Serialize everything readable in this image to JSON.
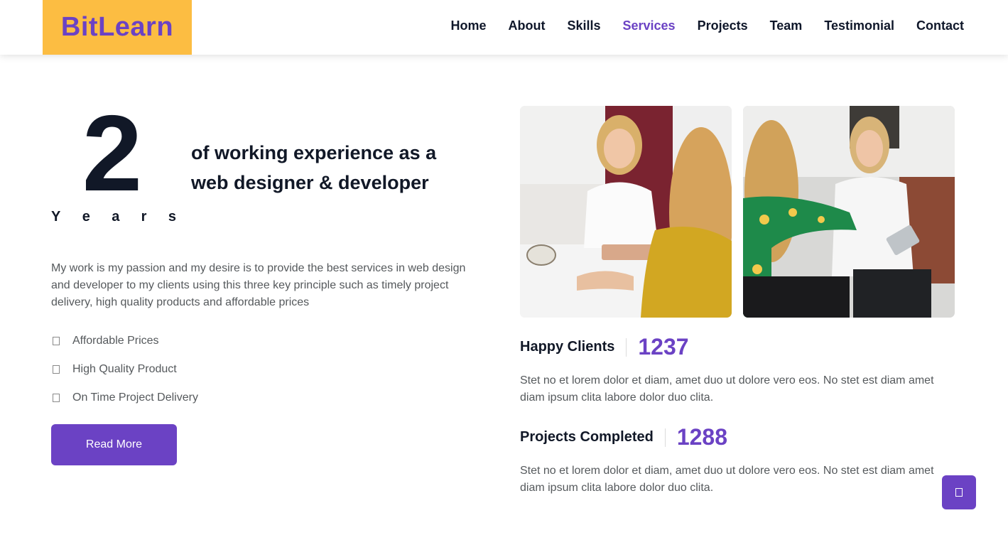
{
  "brand": {
    "name": "BitLearn"
  },
  "nav": {
    "items": [
      "Home",
      "About",
      "Skills",
      "Services",
      "Projects",
      "Team",
      "Testimonial",
      "Contact"
    ],
    "active": "Services"
  },
  "experience": {
    "number": "2",
    "unit_letters": [
      "Y",
      "e",
      "a",
      "r",
      "s"
    ],
    "heading_line1": "of working experience as a",
    "heading_line2": "web designer & developer"
  },
  "about": {
    "paragraph": "My work is my passion and my desire is to provide the best services in web design and developer to my clients using this three key principle such as timely project delivery, high quality products and affordable prices",
    "features": [
      "Affordable Prices",
      "High Quality Product",
      "On Time Project Delivery"
    ],
    "read_more_label": "Read More"
  },
  "stats": [
    {
      "label": "Happy Clients",
      "value": "1237",
      "description": "Stet no et lorem dolor et diam, amet duo ut dolore vero eos. No stet est diam amet diam ipsum clita labore dolor duo clita."
    },
    {
      "label": "Projects Completed",
      "value": "1288",
      "description": "Stet no et lorem dolor et diam, amet duo ut dolore vero eos. No stet est diam amet diam ipsum clita labore dolor duo clita."
    }
  ],
  "icons": {
    "feature_icon": "check-icon",
    "back_to_top": "arrow-up-icon"
  },
  "colors": {
    "accent": "#6b42c4",
    "brand_bg": "#fcbd42",
    "text_dark": "#111827",
    "text_muted": "#55595c"
  }
}
